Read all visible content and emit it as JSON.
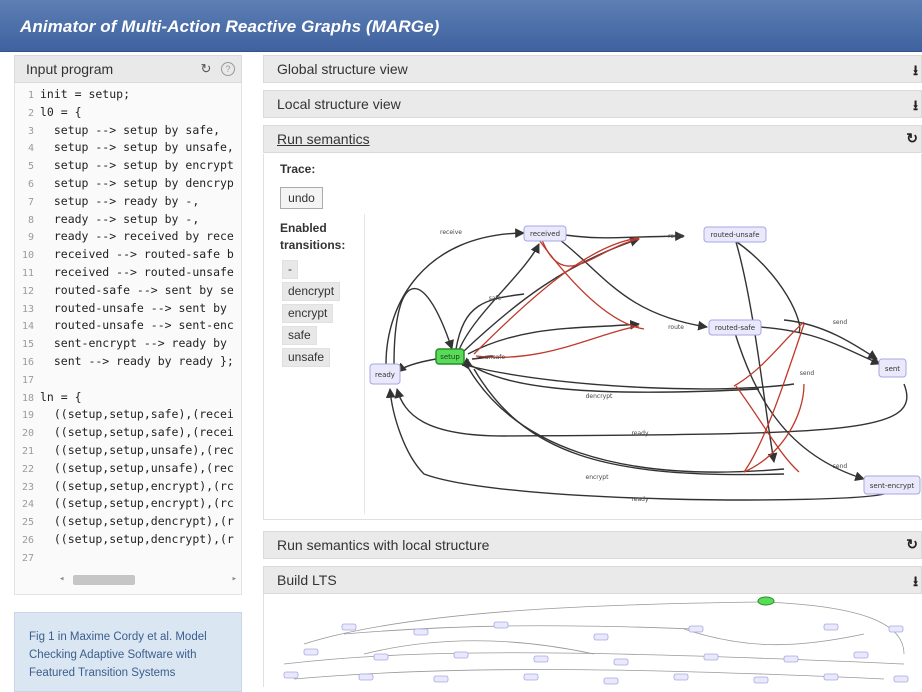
{
  "app": {
    "title": "Animator of Multi-Action Reactive Graphs (MARGe)"
  },
  "input_panel": {
    "title": "Input program",
    "refresh_icon": "refresh-icon",
    "help_icon_text": "?",
    "code": [
      {
        "n": "1",
        "t": "init = setup;"
      },
      {
        "n": "2",
        "t": "l0 = {"
      },
      {
        "n": "3",
        "t": "  setup --> setup by safe,"
      },
      {
        "n": "4",
        "t": "  setup --> setup by unsafe,"
      },
      {
        "n": "5",
        "t": "  setup --> setup by encrypt"
      },
      {
        "n": "6",
        "t": "  setup --> setup by dencryp"
      },
      {
        "n": "7",
        "t": "  setup --> ready by -,"
      },
      {
        "n": "8",
        "t": "  ready --> setup by -,"
      },
      {
        "n": "9",
        "t": "  ready --> received by rece"
      },
      {
        "n": "10",
        "t": "  received --> routed-safe b"
      },
      {
        "n": "11",
        "t": "  received --> routed-unsafe"
      },
      {
        "n": "12",
        "t": "  routed-safe --> sent by se"
      },
      {
        "n": "13",
        "t": "  routed-unsafe --> sent by"
      },
      {
        "n": "14",
        "t": "  routed-unsafe --> sent-enc"
      },
      {
        "n": "15",
        "t": "  sent-encrypt --> ready by"
      },
      {
        "n": "16",
        "t": "  sent --> ready by ready };"
      },
      {
        "n": "17",
        "t": ""
      },
      {
        "n": "18",
        "t": "ln = {"
      },
      {
        "n": "19",
        "t": "  ((setup,setup,safe),(recei"
      },
      {
        "n": "20",
        "t": "  ((setup,setup,safe),(recei"
      },
      {
        "n": "21",
        "t": "  ((setup,setup,unsafe),(rec"
      },
      {
        "n": "22",
        "t": "  ((setup,setup,unsafe),(rec"
      },
      {
        "n": "23",
        "t": "  ((setup,setup,encrypt),(rc"
      },
      {
        "n": "24",
        "t": "  ((setup,setup,encrypt),(rc"
      },
      {
        "n": "25",
        "t": "  ((setup,setup,dencrypt),(r"
      },
      {
        "n": "26",
        "t": "  ((setup,setup,dencrypt),(r"
      },
      {
        "n": "27",
        "t": ""
      }
    ],
    "scroll_left": "◂",
    "scroll_right": "▸",
    "note": "Fig 1 in Maxime Cordy et al. Model Checking Adaptive Software with Featured Transition Systems"
  },
  "sections": {
    "global": {
      "label": "Global structure view",
      "icon": "download-icon",
      "glyph": "⭳"
    },
    "local": {
      "label": "Local structure view",
      "icon": "download-icon",
      "glyph": "⭳"
    },
    "run": {
      "label": "Run semantics",
      "icon": "refresh-icon",
      "glyph": "↻"
    },
    "run_local": {
      "label": "Run semantics with local structure",
      "icon": "refresh-icon",
      "glyph": "↻"
    },
    "lts": {
      "label": "Build LTS",
      "icon": "download-icon",
      "glyph": "⭳"
    }
  },
  "run_semantics": {
    "trace_label": "Trace:",
    "undo_label": "undo",
    "enabled_label_1": "Enabled",
    "enabled_label_2": "transitions:",
    "transitions": [
      "-",
      "dencrypt",
      "encrypt",
      "safe",
      "unsafe"
    ]
  },
  "graph": {
    "nodes": {
      "ready": "ready",
      "setup": "setup",
      "received": "received",
      "routed_unsafe": "routed-unsafe",
      "routed_safe": "routed-safe",
      "sent": "sent",
      "sent_encrypt": "sent-encrypt"
    },
    "edge_labels": {
      "receive": "receive",
      "route1": "route",
      "route2": "route",
      "send1": "send",
      "send2": "send",
      "send3": "send",
      "safe": "safe",
      "unsafe": "unsafe",
      "dencrypt": "dencrypt",
      "encrypt": "encrypt",
      "ready1": "ready",
      "ready2": "ready"
    },
    "colors": {
      "active_node": "#55dd55",
      "node": "#e9e9fb",
      "edge": "#333333",
      "link_edge": "#c0392b"
    }
  }
}
